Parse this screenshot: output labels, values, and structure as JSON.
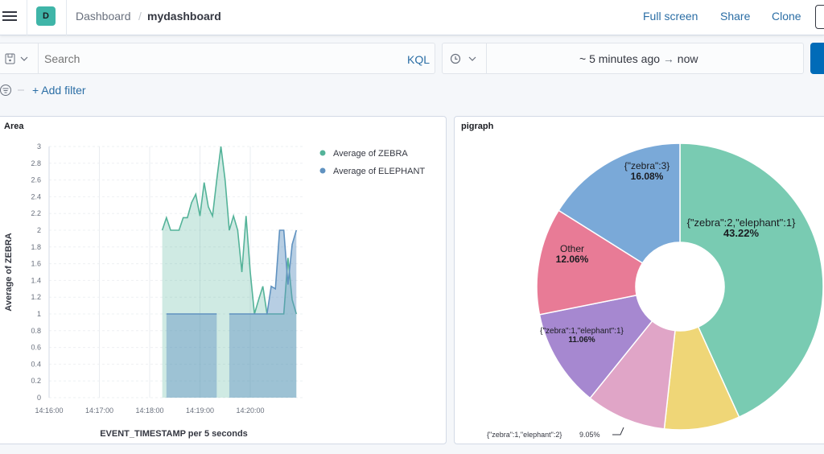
{
  "header": {
    "logo_letter": "D",
    "breadcrumb": [
      "Dashboard",
      "mydashboard"
    ],
    "actions": [
      "Full screen",
      "Share",
      "Clone"
    ]
  },
  "query": {
    "search_placeholder": "Search",
    "language": "KQL",
    "time_range": "~ 5 minutes ago",
    "time_arrow": "→",
    "time_end": "now",
    "add_filter": "+ Add filter"
  },
  "colors": {
    "zebra": "#54b399",
    "elephant": "#6092c0",
    "accent": "#006bb8"
  },
  "chart_data": [
    {
      "type": "area",
      "title": "Area",
      "xlabel": "EVENT_TIMESTAMP per 5 seconds",
      "ylabel": "Average of ZEBRA",
      "ylim": [
        0,
        3
      ],
      "yticks": [
        "0",
        "0.2",
        "0.4",
        "0.6",
        "0.8",
        "1",
        "1.2",
        "1.4",
        "1.6",
        "1.8",
        "2",
        "2.2",
        "2.4",
        "2.6",
        "2.8",
        "3"
      ],
      "xticks": [
        "14:16:00",
        "14:17:00",
        "14:18:00",
        "14:19:00",
        "14:20:00"
      ],
      "grid": true,
      "legend": "top-right",
      "x": [
        "14:18:15",
        "14:18:20",
        "14:18:25",
        "14:18:30",
        "14:18:35",
        "14:18:40",
        "14:18:45",
        "14:18:50",
        "14:18:55",
        "14:19:00",
        "14:19:05",
        "14:19:10",
        "14:19:15",
        "14:19:20",
        "14:19:25",
        "14:19:30",
        "14:19:35",
        "14:19:40",
        "14:19:45",
        "14:19:50",
        "14:19:55",
        "14:20:00",
        "14:20:05",
        "14:20:10",
        "14:20:15",
        "14:20:20",
        "14:20:25",
        "14:20:30",
        "14:20:35",
        "14:20:40",
        "14:20:45",
        "14:20:50",
        "14:20:55"
      ],
      "series": [
        {
          "name": "Average of ZEBRA",
          "values": [
            2,
            2.15,
            2,
            2,
            2,
            2.15,
            2.15,
            2.33,
            2.43,
            2.17,
            2.57,
            2.28,
            2.17,
            2.6,
            3,
            2.6,
            2,
            2.17,
            2,
            1.5,
            2.17,
            1.5,
            1,
            1.17,
            1.33,
            1,
            1,
            1,
            1,
            1,
            1.67,
            1.17,
            1
          ]
        },
        {
          "name": "Average of ELEPHANT",
          "values": [
            null,
            1,
            1,
            1,
            1,
            1,
            1,
            1,
            1,
            1,
            1,
            1,
            1,
            1,
            null,
            null,
            1,
            1,
            1,
            1,
            1,
            1,
            1,
            1,
            1,
            1,
            1.33,
            1.3,
            2,
            2,
            1.35,
            1.83,
            2
          ]
        }
      ]
    },
    {
      "type": "pie",
      "title": "pigraph",
      "donut": true,
      "slices": [
        {
          "label": "{\"zebra\":2,\"elephant\":1}",
          "value": 43.22,
          "pct": "43.22%",
          "color": "#79cbb2"
        },
        {
          "label": "",
          "value": 8.53,
          "pct": "",
          "color": "#efd677"
        },
        {
          "label": "{\"zebra\":1,\"elephant\":2}",
          "value": 9.05,
          "pct": "9.05%",
          "color": "#e0a5c7"
        },
        {
          "label": "{\"zebra\":1,\"elephant\":1}",
          "value": 11.06,
          "pct": "11.06%",
          "color": "#a688d0"
        },
        {
          "label": "Other",
          "value": 12.06,
          "pct": "12.06%",
          "color": "#e87b96"
        },
        {
          "label": "{\"zebra\":3}",
          "value": 16.08,
          "pct": "16.08%",
          "color": "#7aa9d8"
        }
      ]
    }
  ]
}
